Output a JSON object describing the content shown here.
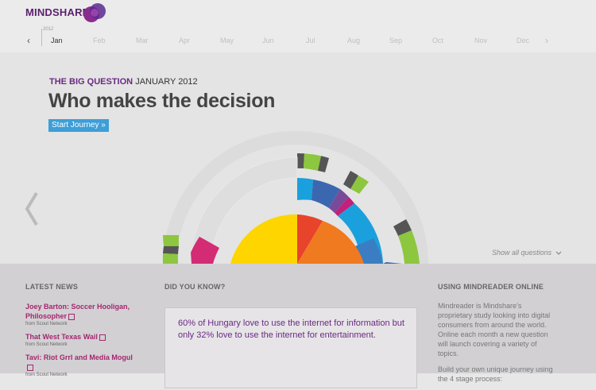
{
  "brand": {
    "name": "MINDSHARE",
    "accent": "#6a2a83",
    "link": "#a4276f",
    "button": "#3d9ed8"
  },
  "timeline": {
    "year": "2012",
    "months": [
      "Jan",
      "Feb",
      "Mar",
      "Apr",
      "May",
      "Jun",
      "Jul",
      "Aug",
      "Sep",
      "Oct",
      "Nov",
      "Dec"
    ],
    "active": "Jan"
  },
  "question": {
    "label": "THE BIG QUESTION",
    "date": "JANUARY 2012",
    "title": "Who makes the decision",
    "cta": "Start Journey »"
  },
  "show_all": "Show all questions",
  "news": {
    "heading": "LATEST NEWS",
    "items": [
      {
        "title": "Joey Barton: Soccer Hooligan, Philosopher",
        "source": "from Scout Network"
      },
      {
        "title": "That West Texas Wail",
        "source": "from Scout Network"
      },
      {
        "title": "Tavi: Riot Grrl and Media Mogul",
        "source": "from Scout Network"
      }
    ]
  },
  "did_you_know": {
    "heading": "DID YOU KNOW?",
    "text": "60% of Hungary love to use the internet for information but only 32% love to use the internet for entertainment."
  },
  "using": {
    "heading": "USING MINDREADER ONLINE",
    "p1": "Mindreader is Mindshare’s proprietary study looking into digital consumers from around the world. Online each month a new question will launch covering a variety of topics.",
    "p2": "Build your own unique journey using the 4 stage process:"
  }
}
